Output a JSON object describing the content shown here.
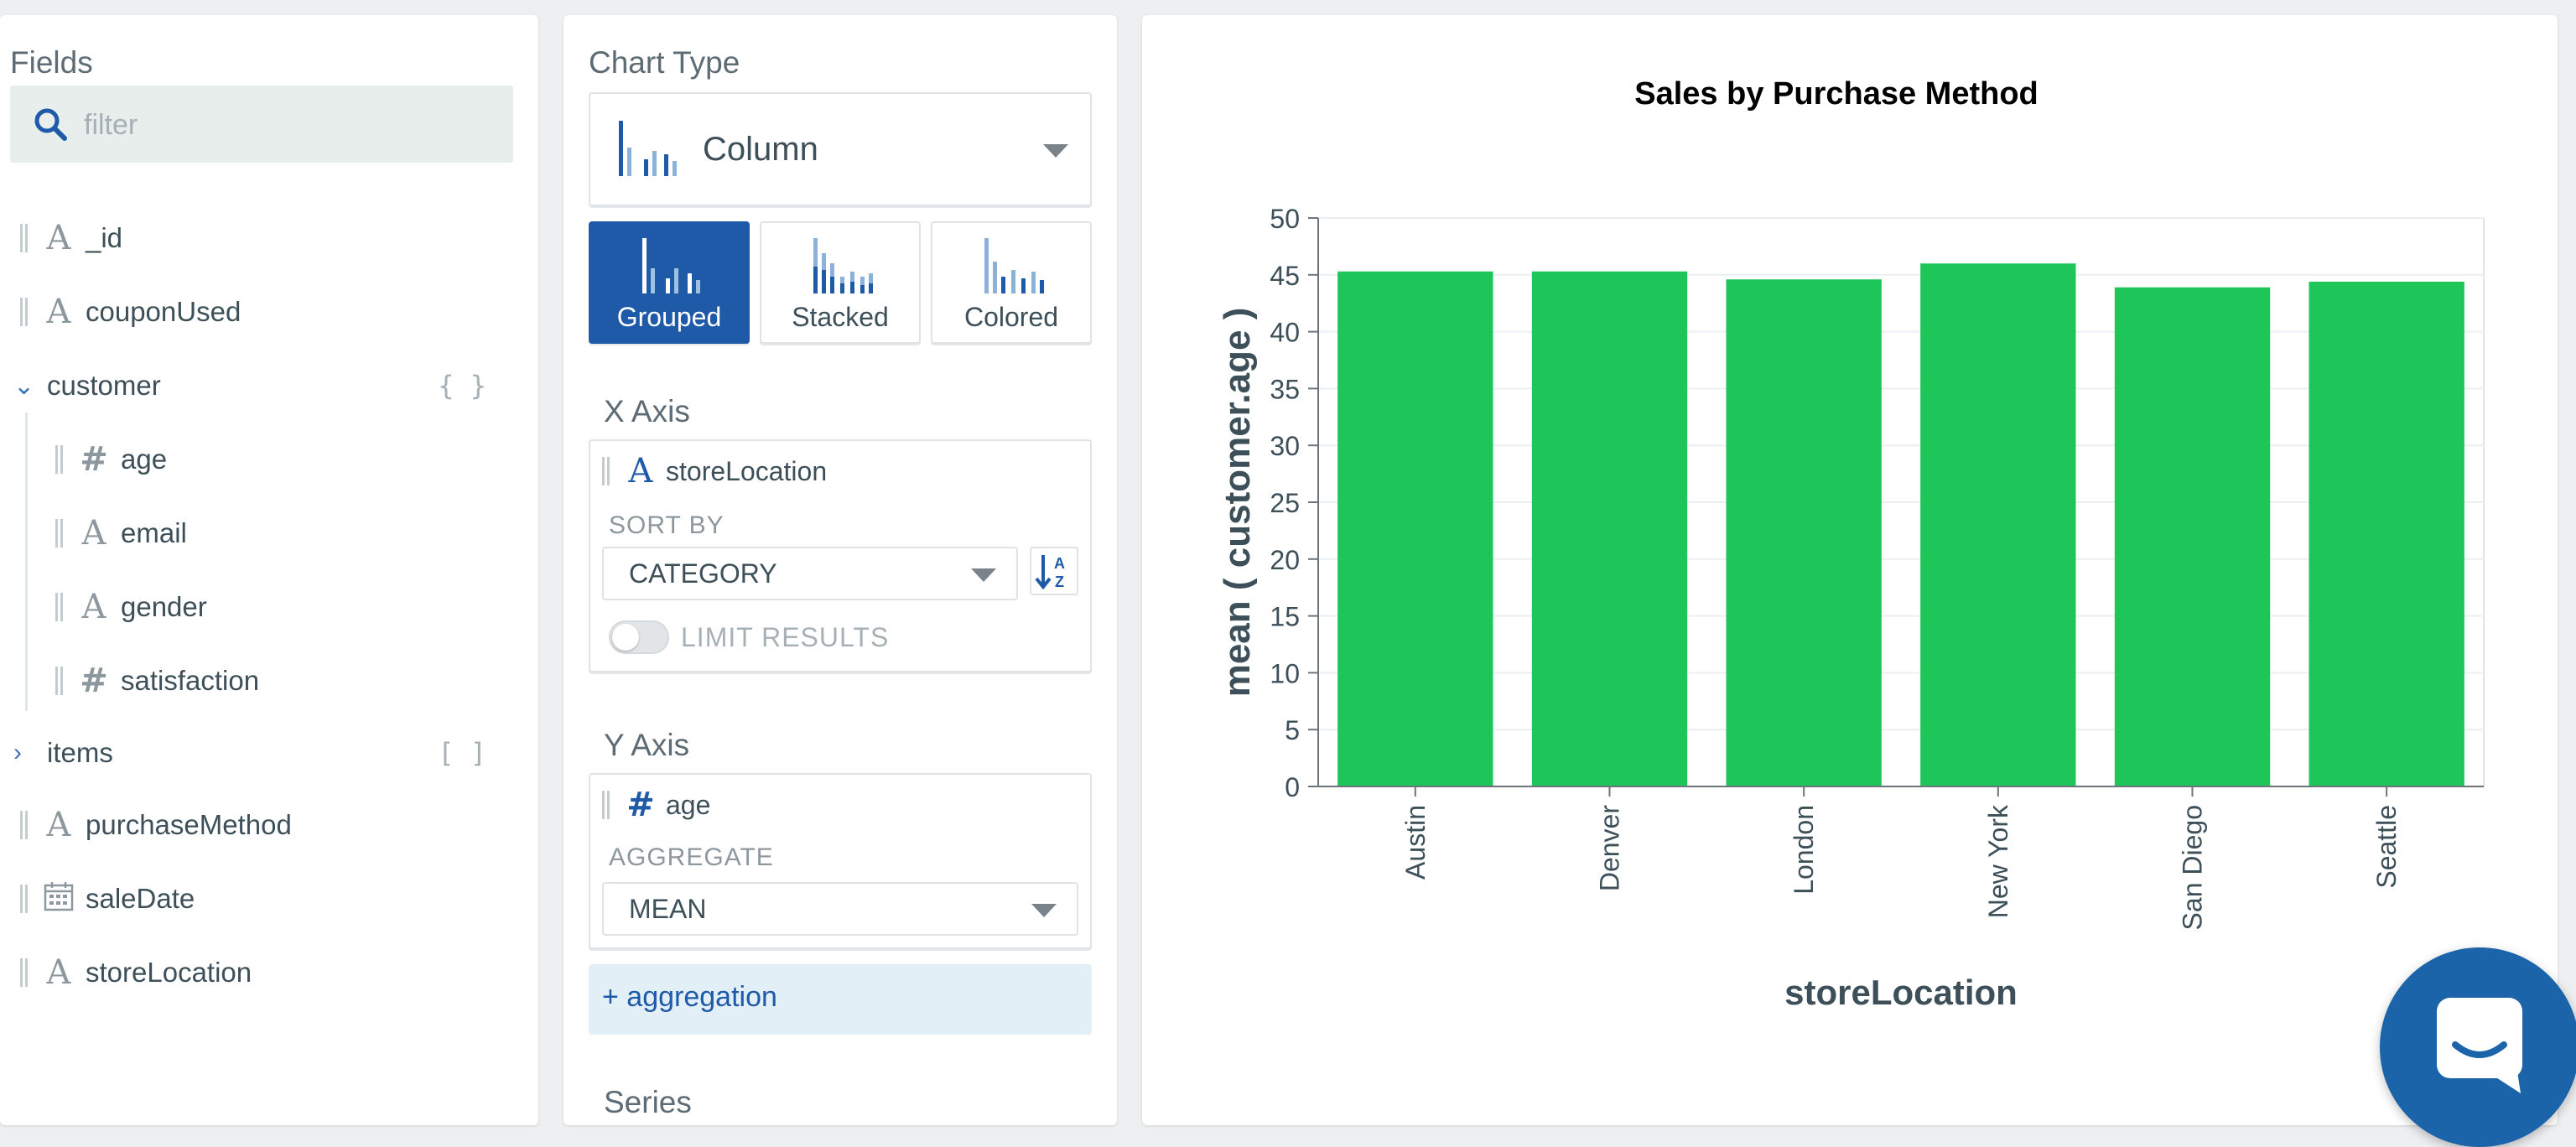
{
  "fields_panel": {
    "title": "Fields",
    "filter_placeholder": "filter",
    "fields": [
      {
        "name": "_id",
        "type": "string"
      },
      {
        "name": "couponUsed",
        "type": "string"
      },
      {
        "name": "customer",
        "type": "object",
        "badge": "{ }",
        "expanded": true
      },
      {
        "name": "age",
        "type": "number"
      },
      {
        "name": "email",
        "type": "string"
      },
      {
        "name": "gender",
        "type": "string"
      },
      {
        "name": "satisfaction",
        "type": "number"
      },
      {
        "name": "items",
        "type": "array",
        "badge": "[ ]",
        "expanded": false
      },
      {
        "name": "purchaseMethod",
        "type": "string"
      },
      {
        "name": "saleDate",
        "type": "date"
      },
      {
        "name": "storeLocation",
        "type": "string"
      }
    ]
  },
  "encode_panel": {
    "chart_type_title": "Chart Type",
    "chart_type": "Column",
    "subtypes": [
      "Grouped",
      "Stacked",
      "Colored"
    ],
    "active_subtype": "Grouped",
    "x_axis": {
      "title": "X Axis",
      "field": "storeLocation",
      "sort_by_label": "SORT BY",
      "sort_by": "CATEGORY",
      "limit_label": "LIMIT RESULTS",
      "limit_enabled": false
    },
    "y_axis": {
      "title": "Y Axis",
      "field": "age",
      "aggregate_label": "AGGREGATE",
      "aggregate": "MEAN"
    },
    "add_aggregation_label": "+ aggregation",
    "series_title": "Series"
  },
  "colors": {
    "bar": "#1ec659",
    "accent": "#1e5aa8",
    "chat": "#1c64a9"
  },
  "chart_data": {
    "type": "bar",
    "title": "Sales by Purchase Method",
    "xlabel": "storeLocation",
    "ylabel": "mean ( customer.age )",
    "categories": [
      "Austin",
      "Denver",
      "London",
      "New York",
      "San Diego",
      "Seattle"
    ],
    "values": [
      45.3,
      45.3,
      44.6,
      46.0,
      43.9,
      44.4
    ],
    "ylim": [
      0,
      50
    ],
    "yticks": [
      0,
      5,
      10,
      15,
      20,
      25,
      30,
      35,
      40,
      45,
      50
    ],
    "grid": true
  }
}
